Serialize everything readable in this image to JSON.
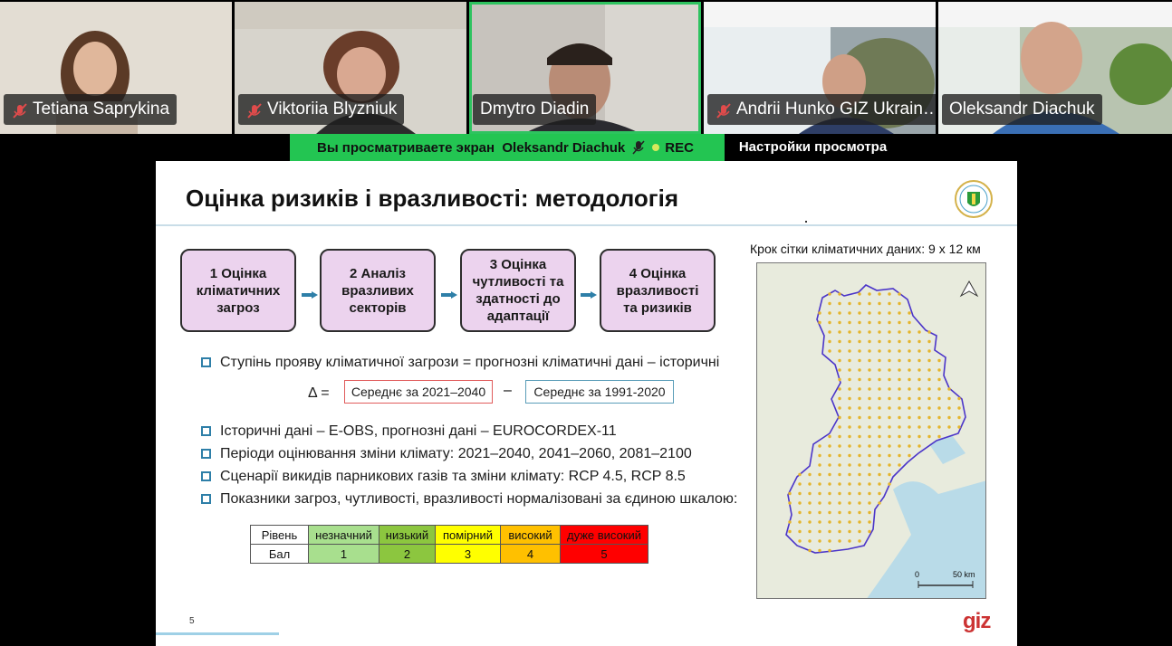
{
  "participants": [
    {
      "name": "Tetiana Saprykina",
      "muted": true
    },
    {
      "name": "Viktoriia Blyzniuk",
      "muted": true
    },
    {
      "name": "Dmytro Diadin",
      "muted": false,
      "active": true
    },
    {
      "name": "Andrii Hunko GIZ Ukrain…",
      "muted": true
    },
    {
      "name": "Oleksandr Diachuk",
      "muted": false
    }
  ],
  "share_bar": {
    "text": "Вы просматриваете экран",
    "presenter": "Oleksandr Diachuk",
    "rec": "REC",
    "settings": "Настройки просмотра"
  },
  "slide": {
    "title": "Оцінка ризиків і вразливості: методологія",
    "steps": [
      "1 Оцінка кліматичних загроз",
      "2 Аналіз вразливих секторів",
      "3 Оцінка чутливості та здатності до адаптації",
      "4 Оцінка вразливості та ризиків"
    ],
    "bullet_main": "Ступінь прояву кліматичної загрози = прогнозні кліматичні дані – історичні",
    "delta_label": "Δ =",
    "formula_a": "Середнє за 2021–2040",
    "formula_minus": "–",
    "formula_b": "Середнє за 1991-2020",
    "bullets": [
      "Історичні дані – E-OBS, прогнозні дані – EUROCORDEX-11",
      "Періоди оцінювання зміни клімату: 2021–2040, 2041–2060, 2081–2100",
      "Сценарії викидів парникових газів та зміни клімату: RCP 4.5, RCP 8.5",
      "Показники загроз, чутливості, вразливості нормалізовані за єдиною шкалою:"
    ],
    "scale": {
      "row1_label": "Рівень",
      "row2_label": "Бал",
      "levels": [
        {
          "name": "незначний",
          "score": "1",
          "color": "#a8df8e"
        },
        {
          "name": "низький",
          "score": "2",
          "color": "#8cc63f"
        },
        {
          "name": "помірний",
          "score": "3",
          "color": "#ffff00"
        },
        {
          "name": "високий",
          "score": "4",
          "color": "#ffc000"
        },
        {
          "name": "дуже високий",
          "score": "5",
          "color": "#ff0000"
        }
      ]
    },
    "map_caption": "Крок сітки кліматичних даних: 9 х 12 км",
    "scale_bar": {
      "zero": "0",
      "distance": "50 km"
    },
    "page_number": "5",
    "brand": "giz"
  },
  "colors": {
    "share_green": "#23c552",
    "step_fill": "#ecd3ee",
    "arrow_blue": "#2e7fa8",
    "active_outline": "#2ec35f"
  }
}
